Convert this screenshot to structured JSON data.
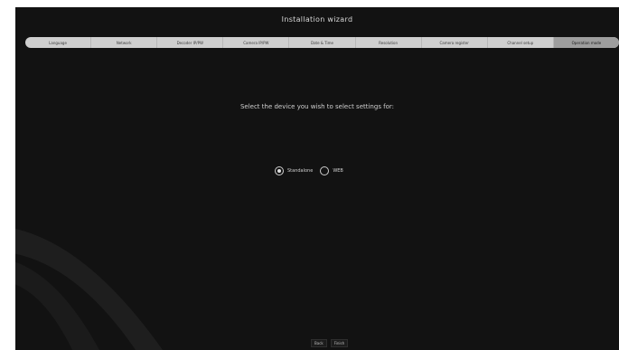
{
  "window": {
    "title": "Installation wizard"
  },
  "steps": [
    {
      "label": "Language",
      "active": false
    },
    {
      "label": "Network",
      "active": false
    },
    {
      "label": "Decoder IP/PW",
      "active": false
    },
    {
      "label": "Camera IP/PW",
      "active": false
    },
    {
      "label": "Date & Time",
      "active": false
    },
    {
      "label": "Resolution",
      "active": false
    },
    {
      "label": "Camera register",
      "active": false
    },
    {
      "label": "Channel setup",
      "active": false
    },
    {
      "label": "Operation mode",
      "active": true
    }
  ],
  "main": {
    "prompt": "Select the device you wish to select settings for:",
    "options": [
      {
        "label": "Standalone",
        "selected": true
      },
      {
        "label": "WEB",
        "selected": false
      }
    ]
  },
  "footer": {
    "back_label": "Back",
    "finish_label": "Finish"
  },
  "colors": {
    "background": "#121212",
    "stepbar": "#cfcfcf",
    "stepbar_active": "#9e9e9e",
    "text": "#d0d0d0"
  }
}
